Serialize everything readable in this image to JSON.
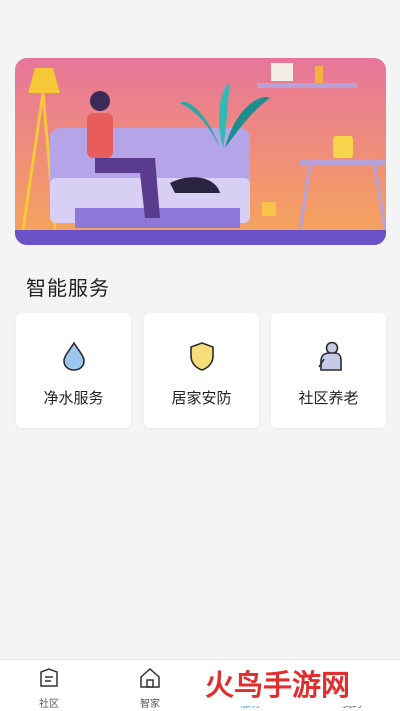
{
  "banner": {
    "alt": "illustration-woman-on-sofa"
  },
  "section": {
    "title": "智能服务"
  },
  "services": [
    {
      "label": "净水服务",
      "icon": "water-drop-icon",
      "color": "#9cc6f0"
    },
    {
      "label": "居家安防",
      "icon": "shield-icon",
      "color": "#f6dc7a"
    },
    {
      "label": "社区养老",
      "icon": "elderly-icon",
      "color": "#c5cbe6"
    }
  ],
  "tabbar": {
    "tabs": [
      {
        "label": "社区",
        "icon": "community-icon"
      },
      {
        "label": "智家",
        "icon": "home-icon"
      },
      {
        "label": "服务",
        "icon": "service-icon",
        "active": true
      },
      {
        "label": "我的",
        "icon": "profile-icon"
      }
    ]
  },
  "watermark": {
    "text": "火鸟手游网"
  },
  "colors": {
    "accent": "#3a8ee6",
    "banner_top": "#e7769a",
    "banner_bottom": "#f6a85a"
  }
}
